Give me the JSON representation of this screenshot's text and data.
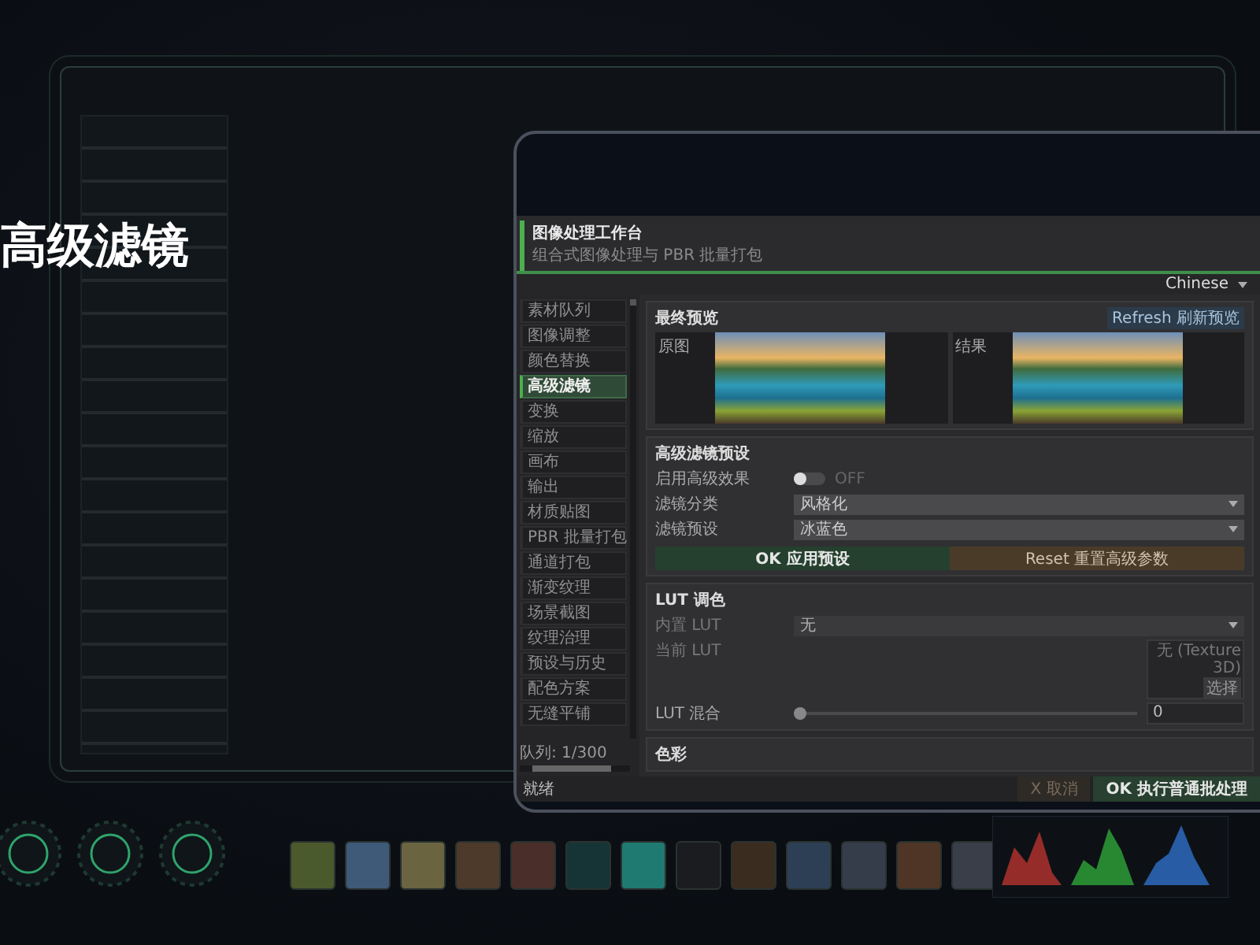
{
  "heading": "高级滤镜",
  "app": {
    "title": "图像处理工作台",
    "subtitle": "组合式图像处理与 PBR 批量打包",
    "language": "Chinese"
  },
  "sidebar": {
    "items": [
      {
        "label": "素材队列",
        "selected": false
      },
      {
        "label": "图像调整",
        "selected": false
      },
      {
        "label": "颜色替换",
        "selected": false
      },
      {
        "label": "高级滤镜",
        "selected": true
      },
      {
        "label": "变换",
        "selected": false
      },
      {
        "label": "缩放",
        "selected": false
      },
      {
        "label": "画布",
        "selected": false
      },
      {
        "label": "输出",
        "selected": false
      },
      {
        "label": "材质贴图",
        "selected": false
      },
      {
        "label": "PBR 批量打包",
        "selected": false
      },
      {
        "label": "通道打包",
        "selected": false
      },
      {
        "label": "渐变纹理",
        "selected": false
      },
      {
        "label": "场景截图",
        "selected": false
      },
      {
        "label": "纹理治理",
        "selected": false
      },
      {
        "label": "预设与历史",
        "selected": false
      },
      {
        "label": "配色方案",
        "selected": false
      },
      {
        "label": "无缝平铺",
        "selected": false
      }
    ],
    "queue": "队列: 1/300"
  },
  "preview": {
    "title": "最终预览",
    "refresh": "Refresh 刷新预览",
    "panes": [
      {
        "label": "原图"
      },
      {
        "label": "结果"
      }
    ]
  },
  "preset": {
    "title": "高级滤镜预设",
    "toggle": {
      "label": "启用高级效果",
      "on": false,
      "state_text": "OFF"
    },
    "selects": [
      {
        "label": "滤镜分类",
        "value": "风格化"
      },
      {
        "label": "滤镜预设",
        "value": "冰蓝色"
      }
    ],
    "apply": "OK 应用预设",
    "reset": "Reset 重置高级参数"
  },
  "lut": {
    "title": "LUT 调色",
    "builtin": {
      "label": "内置 LUT",
      "value": "无"
    },
    "current": {
      "label": "当前 LUT",
      "texture": "无 (Texture 3D)",
      "button": "选择"
    },
    "blend": {
      "label": "LUT 混合",
      "level": 0,
      "value": "0"
    }
  },
  "color": {
    "title": "色彩"
  },
  "status": {
    "text": "就绪",
    "cancel": "X 取消",
    "run": "OK 执行普通批处理"
  }
}
